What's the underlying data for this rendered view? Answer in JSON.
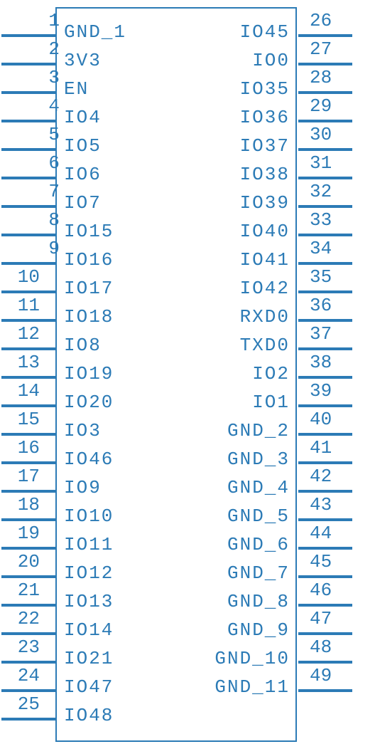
{
  "left_pins": [
    {
      "num": "1",
      "label": "GND_1"
    },
    {
      "num": "2",
      "label": "3V3"
    },
    {
      "num": "3",
      "label": "EN"
    },
    {
      "num": "4",
      "label": "IO4"
    },
    {
      "num": "5",
      "label": "IO5"
    },
    {
      "num": "6",
      "label": "IO6"
    },
    {
      "num": "7",
      "label": "IO7"
    },
    {
      "num": "8",
      "label": "IO15"
    },
    {
      "num": "9",
      "label": "IO16"
    },
    {
      "num": "10",
      "label": "IO17"
    },
    {
      "num": "11",
      "label": "IO18"
    },
    {
      "num": "12",
      "label": "IO8"
    },
    {
      "num": "13",
      "label": "IO19"
    },
    {
      "num": "14",
      "label": "IO20"
    },
    {
      "num": "15",
      "label": "IO3"
    },
    {
      "num": "16",
      "label": "IO46"
    },
    {
      "num": "17",
      "label": "IO9"
    },
    {
      "num": "18",
      "label": "IO10"
    },
    {
      "num": "19",
      "label": "IO11"
    },
    {
      "num": "20",
      "label": "IO12"
    },
    {
      "num": "21",
      "label": "IO13"
    },
    {
      "num": "22",
      "label": "IO14"
    },
    {
      "num": "23",
      "label": "IO21"
    },
    {
      "num": "24",
      "label": "IO47"
    },
    {
      "num": "25",
      "label": "IO48"
    }
  ],
  "right_pins": [
    {
      "num": "26",
      "label": "IO45"
    },
    {
      "num": "27",
      "label": "IO0"
    },
    {
      "num": "28",
      "label": "IO35"
    },
    {
      "num": "29",
      "label": "IO36"
    },
    {
      "num": "30",
      "label": "IO37"
    },
    {
      "num": "31",
      "label": "IO38"
    },
    {
      "num": "32",
      "label": "IO39"
    },
    {
      "num": "33",
      "label": "IO40"
    },
    {
      "num": "34",
      "label": "IO41"
    },
    {
      "num": "35",
      "label": "IO42"
    },
    {
      "num": "36",
      "label": "RXD0"
    },
    {
      "num": "37",
      "label": "TXD0"
    },
    {
      "num": "38",
      "label": "IO2"
    },
    {
      "num": "39",
      "label": "IO1"
    },
    {
      "num": "40",
      "label": "GND_2"
    },
    {
      "num": "41",
      "label": "GND_3"
    },
    {
      "num": "42",
      "label": "GND_4"
    },
    {
      "num": "43",
      "label": "GND_5"
    },
    {
      "num": "44",
      "label": "GND_6"
    },
    {
      "num": "45",
      "label": "GND_7"
    },
    {
      "num": "46",
      "label": "GND_8"
    },
    {
      "num": "47",
      "label": "GND_9"
    },
    {
      "num": "48",
      "label": "GND_10"
    },
    {
      "num": "49",
      "label": "GND_11"
    }
  ]
}
